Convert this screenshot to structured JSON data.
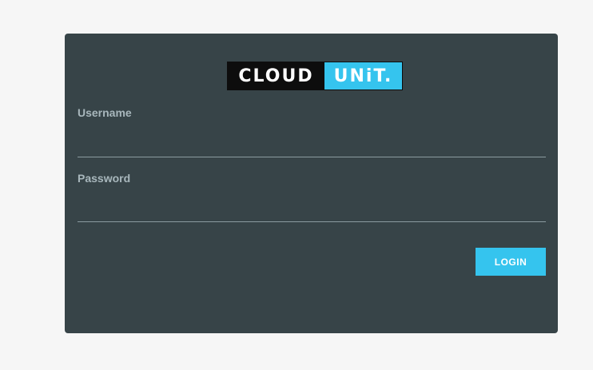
{
  "logo": {
    "left_text": "CLOUD",
    "right_text": "UNiT."
  },
  "form": {
    "username_label": "Username",
    "username_value": "",
    "password_label": "Password",
    "password_value": "",
    "login_label": "LOGIN"
  },
  "colors": {
    "page_background": "#f6f6f6",
    "card_background": "#374448",
    "accent": "#35c4ee",
    "label": "#a8b7bc"
  }
}
